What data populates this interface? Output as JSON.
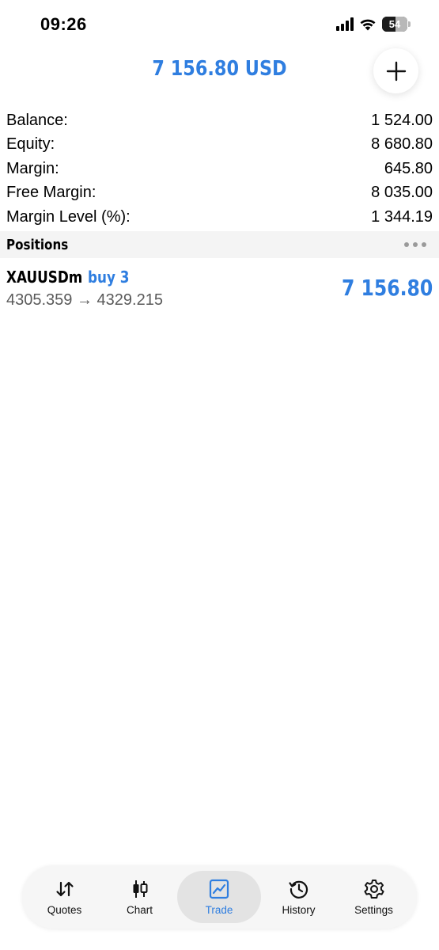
{
  "status_bar": {
    "time": "09:26",
    "battery": "54",
    "battery_level": 0.54
  },
  "header": {
    "title": "7 156.80 USD"
  },
  "account": {
    "rows": [
      {
        "label": "Balance:",
        "value": "1 524.00"
      },
      {
        "label": "Equity:",
        "value": "8 680.80"
      },
      {
        "label": "Margin:",
        "value": "645.80"
      },
      {
        "label": "Free Margin:",
        "value": "8 035.00"
      },
      {
        "label": "Margin Level (%):",
        "value": "1 344.19"
      }
    ]
  },
  "positions": {
    "title": "Positions",
    "items": [
      {
        "symbol": "XAUUSDm",
        "type": "buy 3",
        "prices": "4305.359 → 4329.215",
        "profit": "7 156.80"
      }
    ]
  },
  "tabs": [
    {
      "label": "Quotes",
      "icon": "quotes-icon"
    },
    {
      "label": "Chart",
      "icon": "chart-icon"
    },
    {
      "label": "Trade",
      "icon": "trade-icon",
      "active": true
    },
    {
      "label": "History",
      "icon": "history-icon"
    },
    {
      "label": "Settings",
      "icon": "settings-icon"
    }
  ],
  "colors": {
    "accent": "#2f7ee0",
    "section_bg": "#f4f4f4",
    "tab_bar_bg": "#f6f6f6"
  }
}
